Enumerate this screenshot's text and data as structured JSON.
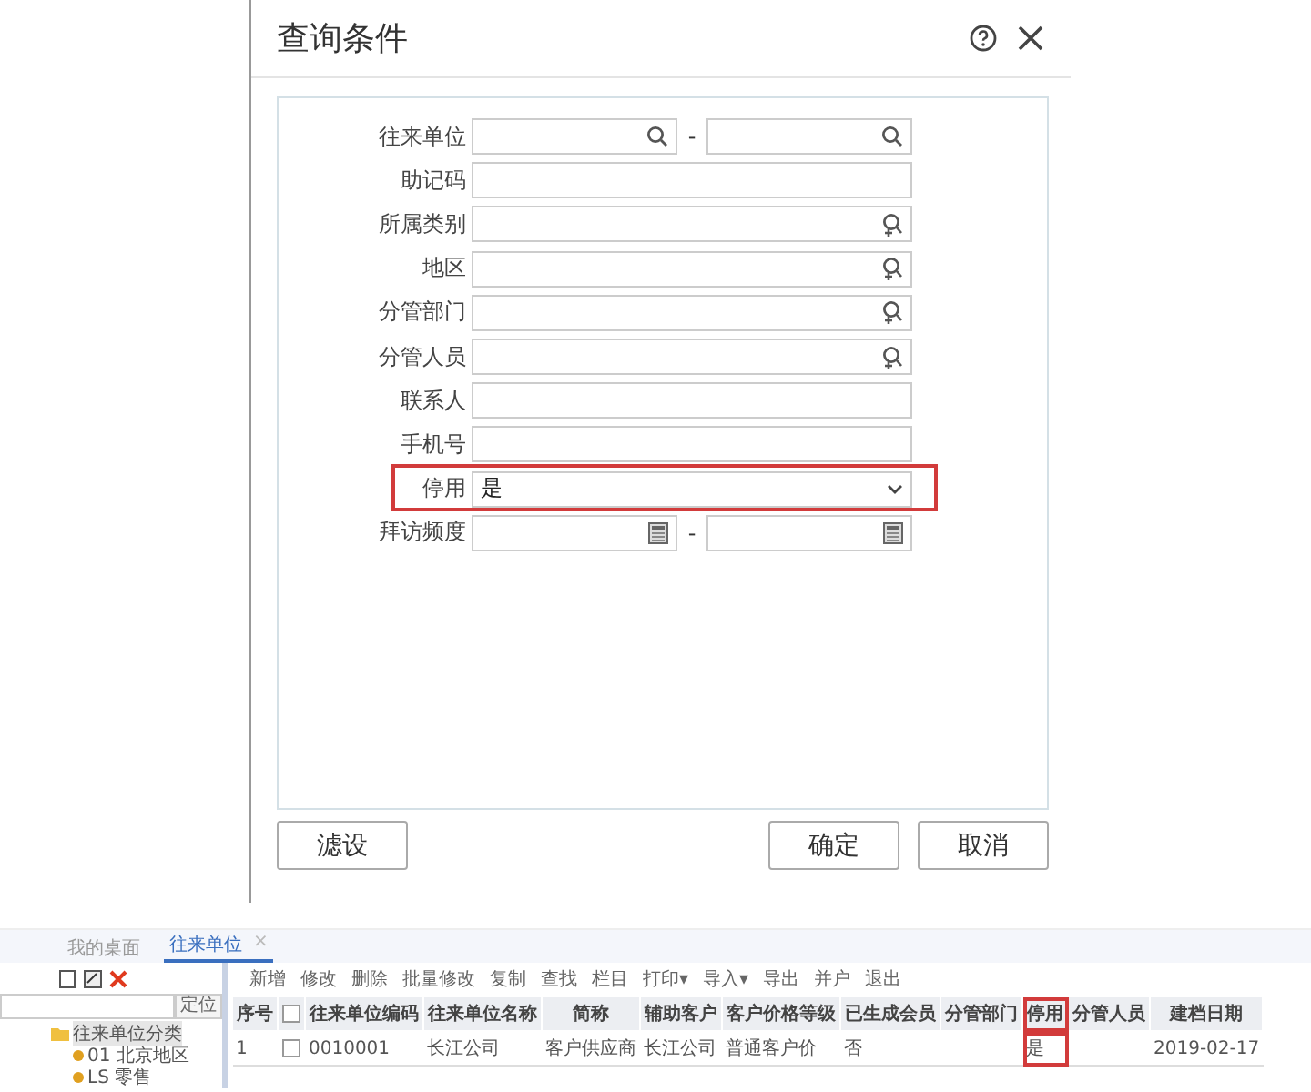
{
  "dialog": {
    "title": "查询条件",
    "fields": [
      {
        "label": "往来单位",
        "kind": "lookuprange"
      },
      {
        "label": "助记码",
        "kind": "text"
      },
      {
        "label": "所属类别",
        "kind": "ref"
      },
      {
        "label": "地区",
        "kind": "ref"
      },
      {
        "label": "分管部门",
        "kind": "ref"
      },
      {
        "label": "分管人员",
        "kind": "ref"
      },
      {
        "label": "联系人",
        "kind": "text"
      },
      {
        "label": "手机号",
        "kind": "text"
      },
      {
        "label": "停用",
        "kind": "select",
        "value": "是",
        "highlighted": true
      },
      {
        "label": "拜访频度",
        "kind": "daterange"
      }
    ],
    "range_separator": "-",
    "left_buttons": [
      "滤设"
    ],
    "buttons": [
      "确定",
      "取消"
    ]
  },
  "app": {
    "tabs": [
      {
        "label": "我的桌面",
        "selected": false,
        "closable": false
      },
      {
        "label": "往来单位",
        "selected": true,
        "closable": true
      }
    ],
    "close_mark": "×",
    "locate_button": "定位",
    "tree": [
      {
        "label": "往来单位分类",
        "selected": true,
        "children": [
          {
            "label": "01 北京地区",
            "selected": false
          },
          {
            "label": "LS 零售",
            "selected": false
          }
        ]
      }
    ],
    "toolbar": [
      {
        "label": "新增"
      },
      {
        "label": "修改"
      },
      {
        "label": "删除"
      },
      {
        "label": "批量修改"
      },
      {
        "label": "复制"
      },
      {
        "label": "查找"
      },
      {
        "label": "栏目"
      },
      {
        "label": "打印",
        "menu": true
      },
      {
        "label": "导入",
        "menu": true
      },
      {
        "label": "导出"
      },
      {
        "label": "并户"
      },
      {
        "label": "退出"
      }
    ],
    "dropdown_mark": "▾",
    "table": {
      "header_checked": false,
      "columns": [
        {
          "label": "序号",
          "kind": "text"
        },
        {
          "kind": "checkbox"
        },
        {
          "label": "往来单位编码",
          "kind": "text"
        },
        {
          "label": "往来单位名称",
          "kind": "text"
        },
        {
          "label": "简称",
          "kind": "text"
        },
        {
          "label": "辅助客户",
          "kind": "text"
        },
        {
          "label": "客户价格等级",
          "kind": "text"
        },
        {
          "label": "已生成会员",
          "kind": "text"
        },
        {
          "label": "分管部门",
          "kind": "text"
        },
        {
          "label": "停用",
          "kind": "text",
          "highlighted": true
        },
        {
          "label": "分管人员",
          "kind": "text"
        },
        {
          "label": "建档日期",
          "kind": "text"
        }
      ],
      "rows": [
        {
          "checked": false,
          "cells": [
            "1",
            "",
            "0010001",
            "长江公司",
            "客户供应商",
            "长江公司",
            "普通客户价",
            "否",
            "",
            "是",
            "",
            "2019-02-17"
          ]
        }
      ]
    }
  }
}
